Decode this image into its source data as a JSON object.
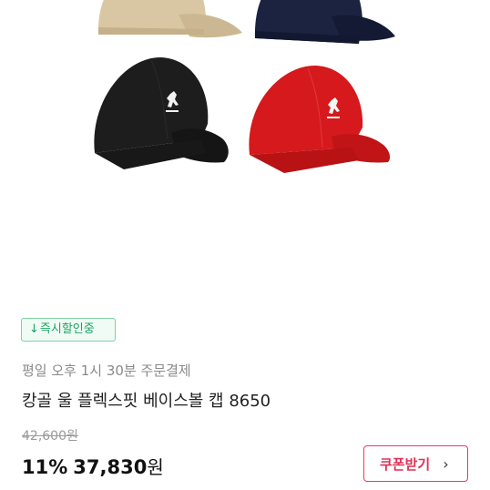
{
  "product": {
    "images": [
      {
        "name": "cap-beige",
        "color": "#d9c7a4"
      },
      {
        "name": "cap-navy",
        "color": "#1c2340"
      },
      {
        "name": "cap-black",
        "color": "#1d1d1d"
      },
      {
        "name": "cap-red",
        "color": "#d5191c"
      }
    ],
    "badge": {
      "arrow": "↓",
      "label": "즉시할인중",
      "color": "#1aa463"
    },
    "delivery_note": "평일 오후 1시 30분 주문결제",
    "title": "캉골 울 플렉스핏 베이스볼 캡 8650",
    "original_price": "42,600원",
    "discount_rate": "11%",
    "sale_price": "37,830",
    "currency": "원",
    "coupon_button": {
      "label": "쿠폰받기",
      "icon": "chevron-right-icon",
      "color": "#e03157"
    }
  }
}
